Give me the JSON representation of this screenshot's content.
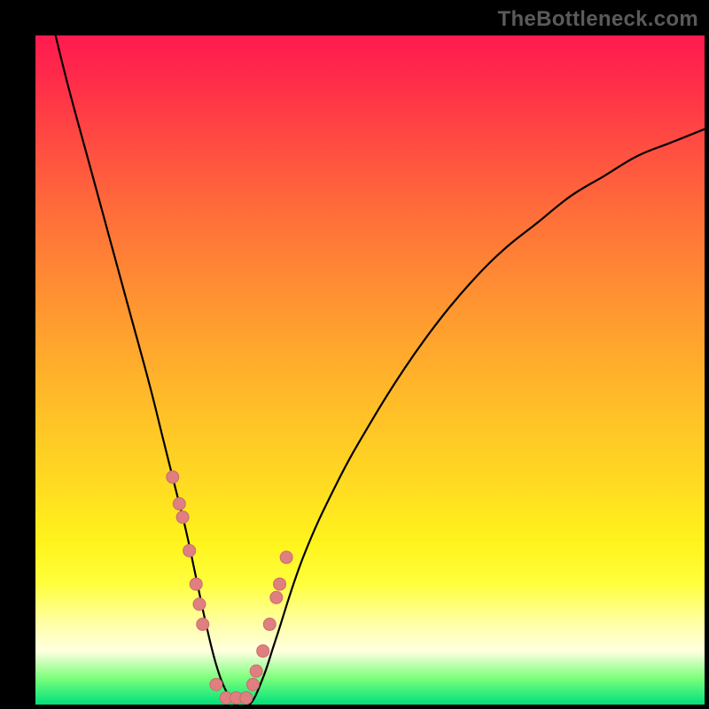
{
  "watermark": "TheBottleneck.com",
  "chart_data": {
    "type": "line",
    "title": "",
    "xlabel": "",
    "ylabel": "",
    "xlim": [
      0,
      100
    ],
    "ylim": [
      0,
      100
    ],
    "grid": false,
    "legend": false,
    "series": [
      {
        "name": "bottleneck-curve",
        "x": [
          3,
          5,
          8,
          11,
          14,
          17,
          19,
          21,
          22.5,
          24,
          25.5,
          27,
          28.5,
          30,
          32,
          34,
          36,
          40,
          45,
          50,
          55,
          60,
          65,
          70,
          75,
          80,
          85,
          90,
          95,
          100
        ],
        "y": [
          100,
          92,
          81,
          70,
          59,
          48,
          40,
          32,
          26,
          19,
          12,
          6,
          2,
          0,
          0,
          4,
          10,
          22,
          33,
          42,
          50,
          57,
          63,
          68,
          72,
          76,
          79,
          82,
          84,
          86
        ]
      }
    ],
    "markers": {
      "name": "component-points",
      "x": [
        20.5,
        21.5,
        22.0,
        23.0,
        24.0,
        24.5,
        25.0,
        27.0,
        28.5,
        30.0,
        31.5,
        32.5,
        33.0,
        34.0,
        35.0,
        36.0,
        36.5,
        37.5
      ],
      "y": [
        34,
        30,
        28,
        23,
        18,
        15,
        12,
        3,
        1,
        1,
        1,
        3,
        5,
        8,
        12,
        16,
        18,
        22
      ],
      "color": "#e08080",
      "radius": 7
    },
    "colors": {
      "curve": "#000000",
      "marker_fill": "#df7f7f",
      "marker_stroke": "#c96d6d",
      "gradient_top": "#ff1a4e",
      "gradient_bottom": "#00e07a"
    }
  }
}
